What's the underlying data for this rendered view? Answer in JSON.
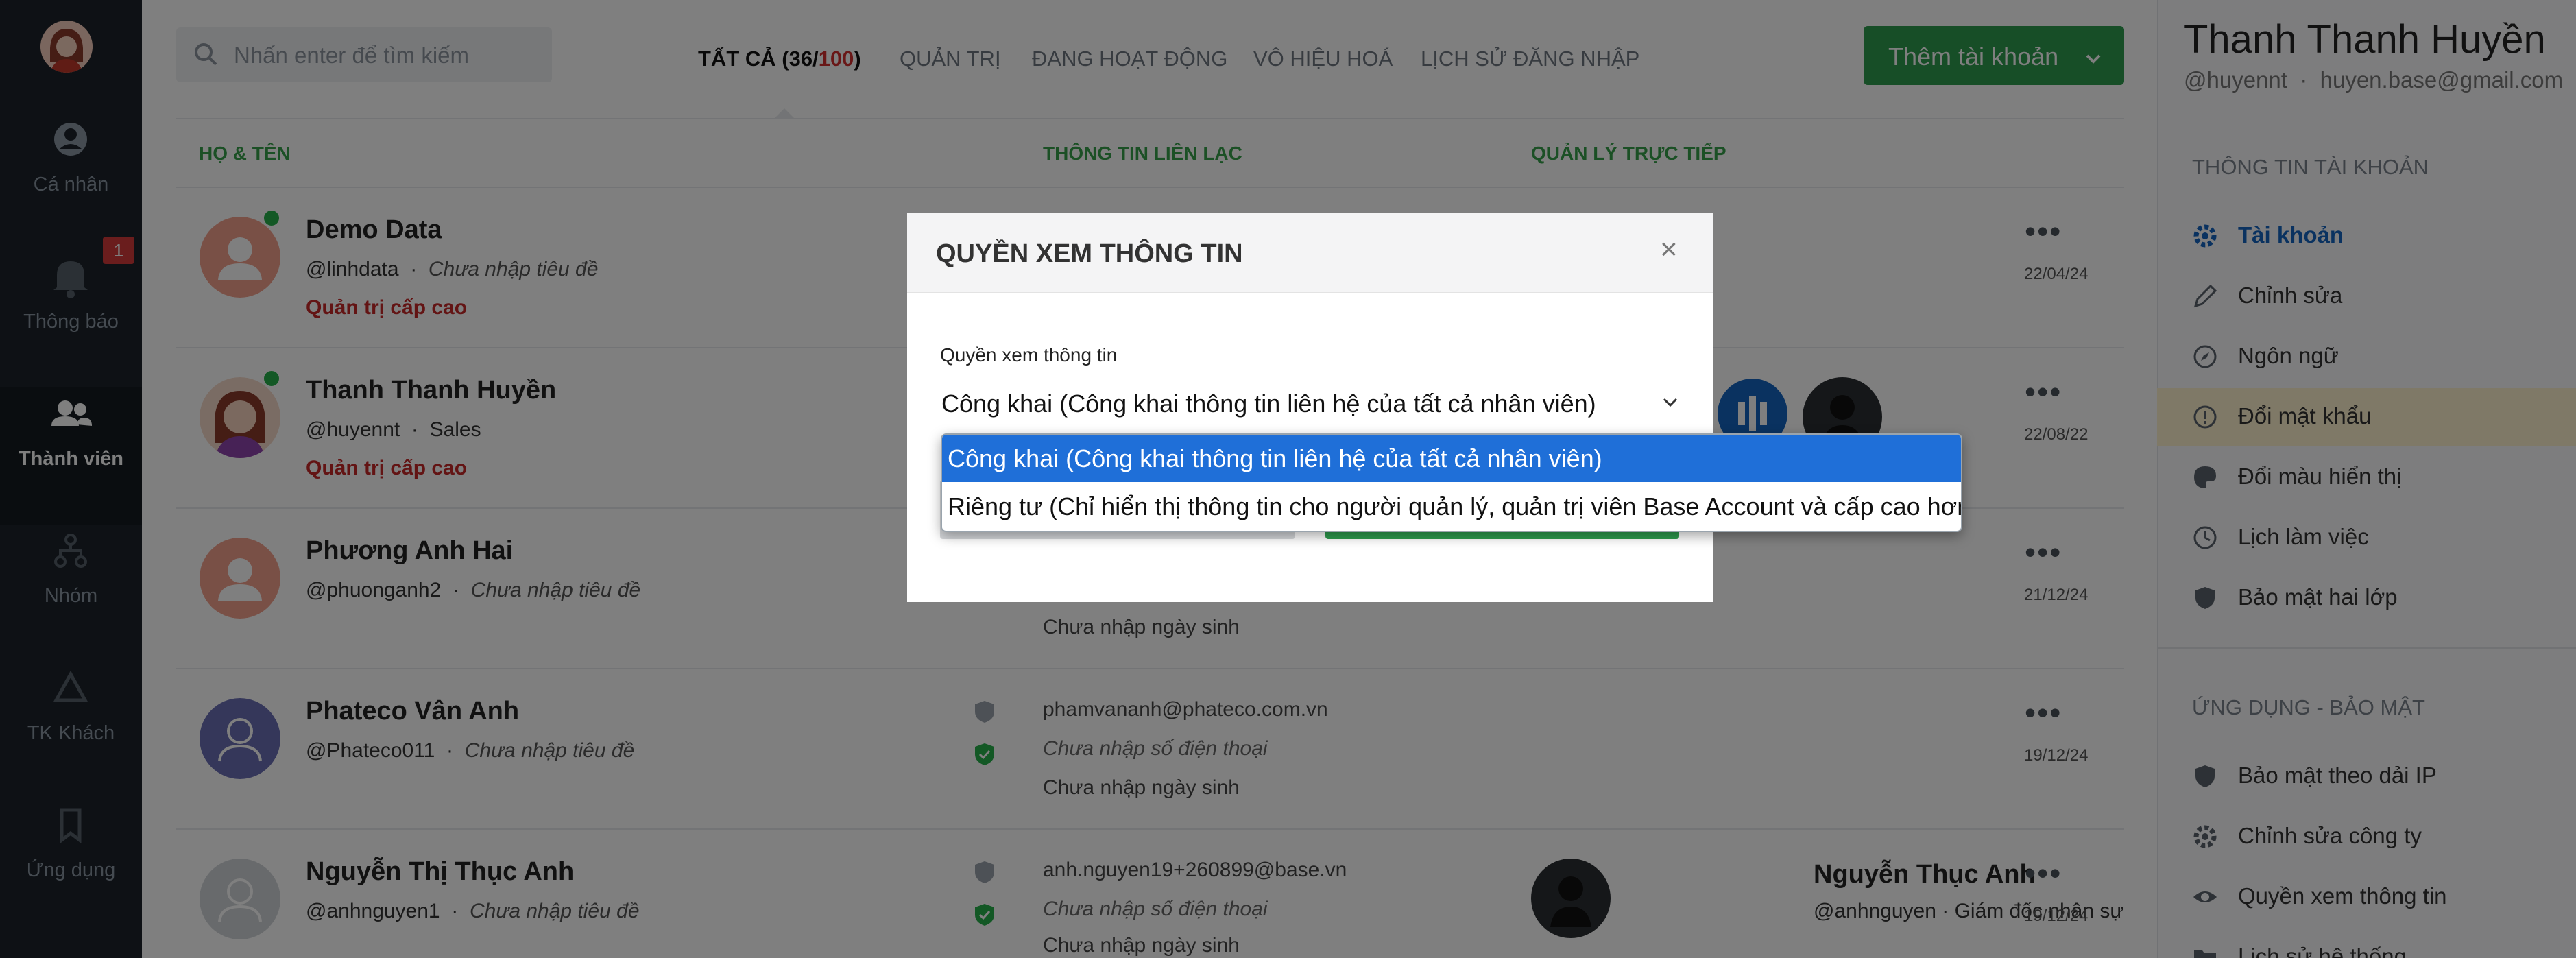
{
  "rail": {
    "items": [
      {
        "label": "Cá nhân",
        "icon": "user-circle-icon"
      },
      {
        "label": "Thông báo",
        "icon": "bell-icon",
        "badge": "1"
      },
      {
        "label": "Thành viên",
        "icon": "users-icon"
      },
      {
        "label": "Nhóm",
        "icon": "group-tree-icon"
      },
      {
        "label": "TK Khách",
        "icon": "triangle-icon"
      },
      {
        "label": "Ứng dụng",
        "icon": "bookmark-icon"
      }
    ]
  },
  "search": {
    "placeholder": "Nhấn enter để tìm kiếm"
  },
  "tabs": {
    "all_prefix": "TẤT CẢ (36/",
    "all_total": "100",
    "all_suffix": ")",
    "admin": "QUẢN TRỊ",
    "active": "ĐANG HOẠT ĐỘNG",
    "disabled": "VÔ HIỆU HOÁ",
    "login_history": "LỊCH SỬ ĐĂNG NHẬP"
  },
  "add_account": {
    "label": "Thêm tài khoản"
  },
  "columns": {
    "name": "HỌ & TÊN",
    "contact": "THÔNG TIN LIÊN LẠC",
    "manager": "QUẢN LÝ TRỰC TIẾP"
  },
  "members": [
    {
      "name": "Demo Data",
      "handle": "@linhdata",
      "title": "Chưa nhập tiêu đề",
      "role": "Quản trị cấp cao",
      "date": "22/04/24"
    },
    {
      "name": "Thanh Thanh Huyền",
      "handle": "@huyennt",
      "title": "Sales",
      "role": "Quản trị cấp cao",
      "date": "22/08/22"
    },
    {
      "name": "Phương Anh Hai",
      "handle": "@phuonganh2",
      "title": "Chưa nhập tiêu đề",
      "date": "21/12/24",
      "birthday": "Chưa nhập ngày sinh"
    },
    {
      "name": "Phateco Vân Anh",
      "handle": "@Phateco011",
      "title": "Chưa nhập tiêu đề",
      "date": "19/12/24",
      "email": "phamvananh@phateco.com.vn",
      "phone": "Chưa nhập số điện thoại",
      "birthday": "Chưa nhập ngày sinh"
    },
    {
      "name": "Nguyễn Thị Thục Anh",
      "handle": "@anhnguyen1",
      "title": "Chưa nhập tiêu đề",
      "date": "19/12/24",
      "email": "anh.nguyen19+260899@base.vn",
      "phone": "Chưa nhập số điện thoại",
      "birthday": "Chưa nhập ngày sinh",
      "manager_name": "Nguyễn Thục Anh",
      "manager_info": "@anhnguyen · Giám đốc nhân sự"
    }
  ],
  "right_panel": {
    "name": "Thanh Thanh Huyền",
    "handle": "@huyennt",
    "email": "huyen.base@gmail.com",
    "section_account": "THÔNG TIN TÀI KHOẢN",
    "account_items": [
      {
        "label": "Tài khoản",
        "icon": "gear-icon"
      },
      {
        "label": "Chỉnh sửa",
        "icon": "pencil-icon"
      },
      {
        "label": "Ngôn ngữ",
        "icon": "compass-icon"
      },
      {
        "label": "Đổi mật khẩu",
        "icon": "alert-circle-icon"
      },
      {
        "label": "Đổi màu hiển thị",
        "icon": "palette-icon"
      },
      {
        "label": "Lịch làm việc",
        "icon": "clock-icon"
      },
      {
        "label": "Bảo mật hai lớp",
        "icon": "shield-icon"
      }
    ],
    "section_apps": "ỨNG DỤNG - BẢO MẬT",
    "app_items": [
      {
        "label": "Bảo mật theo dải IP",
        "icon": "shield-icon"
      },
      {
        "label": "Chỉnh sửa công ty",
        "icon": "gear-icon"
      },
      {
        "label": "Quyền xem thông tin",
        "icon": "eye-icon"
      },
      {
        "label": "Lịch sử hệ thống",
        "icon": "folder-icon"
      }
    ]
  },
  "modal": {
    "title": "QUYỀN XEM THÔNG TIN",
    "field_label": "Quyền xem thông tin",
    "selected": "Công khai (Công khai thông tin liên hệ của tất cả nhân viên)",
    "options": [
      "Công khai (Công khai thông tin liên hệ của tất cả nhân viên)",
      "Riêng tư (Chỉ hiển thị thông tin cho người quản lý, quản trị viên Base Account và cấp cao hơn)"
    ]
  },
  "colors": {
    "brand_green": "#2e9d4f",
    "danger_red": "#c62828",
    "link_blue": "#1565c0",
    "select_blue": "#1f6fd8"
  }
}
